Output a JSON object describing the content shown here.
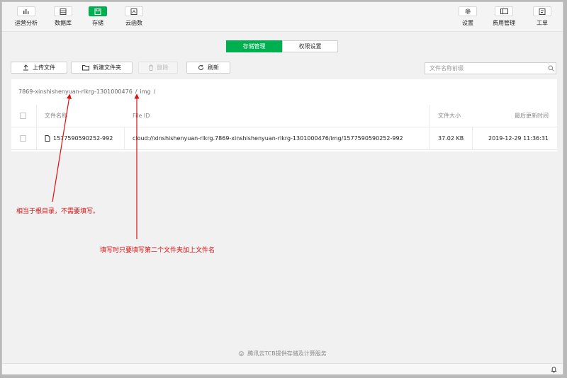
{
  "toolbar": {
    "left": [
      {
        "label": "运营分析",
        "icon": "bar-chart-icon"
      },
      {
        "label": "数据库",
        "icon": "database-icon"
      },
      {
        "label": "存储",
        "icon": "storage-icon",
        "active": true
      },
      {
        "label": "云函数",
        "icon": "cloud-function-icon"
      }
    ],
    "right": [
      {
        "label": "设置",
        "icon": "gear-icon"
      },
      {
        "label": "费用管理",
        "icon": "billing-icon"
      },
      {
        "label": "工单",
        "icon": "ticket-icon"
      }
    ]
  },
  "tabs": [
    {
      "label": "存储管理",
      "active": true
    },
    {
      "label": "权限设置",
      "active": false
    }
  ],
  "actions": {
    "upload": "上传文件",
    "new_folder": "新建文件夹",
    "delete": "删除",
    "refresh": "刷新"
  },
  "search": {
    "placeholder": "文件名称前缀"
  },
  "breadcrumb": {
    "root": "7869-xinshishenyuan-rlkrg-1301000476",
    "sep1": "/",
    "folder": "img",
    "sep2": "/"
  },
  "table": {
    "headers": {
      "name": "文件名称",
      "file_id": "File ID",
      "size": "文件大小",
      "updated": "最后更新时间"
    },
    "rows": [
      {
        "name": "1577590590252-992",
        "file_id": "cloud://xinshishenyuan-rlkrg.7869-xinshishenyuan-rlkrg-1301000476/img/1577590590252-992",
        "size": "37.02 KB",
        "updated": "2019-12-29 11:36:31"
      }
    ]
  },
  "annotations": {
    "note1": "相当于根目录，不需要填写。",
    "note2": "填写时只要填写第二个文件夹加上文件名"
  },
  "footer": {
    "text": "腾讯云TCB提供存储及计算服务"
  },
  "colors": {
    "accent": "#00b050",
    "annotation": "#e01010"
  }
}
